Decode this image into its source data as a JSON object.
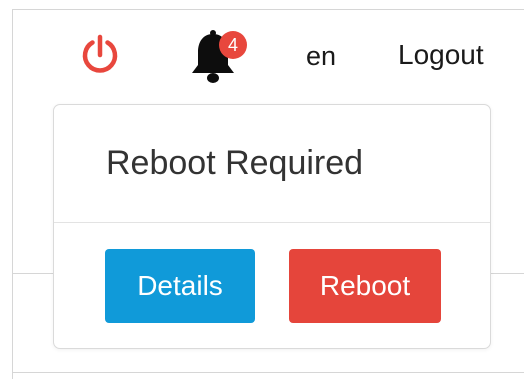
{
  "header": {
    "power_icon": "power-icon",
    "power_color": "#e8473d",
    "bell_icon": "bell-icon",
    "notification_count": "4",
    "badge_color": "#e8473d",
    "language": "en",
    "logout_label": "Logout"
  },
  "popover": {
    "title": "Reboot Required",
    "details_label": "Details",
    "reboot_label": "Reboot",
    "details_color": "#109ad9",
    "reboot_color": "#e5453b"
  }
}
